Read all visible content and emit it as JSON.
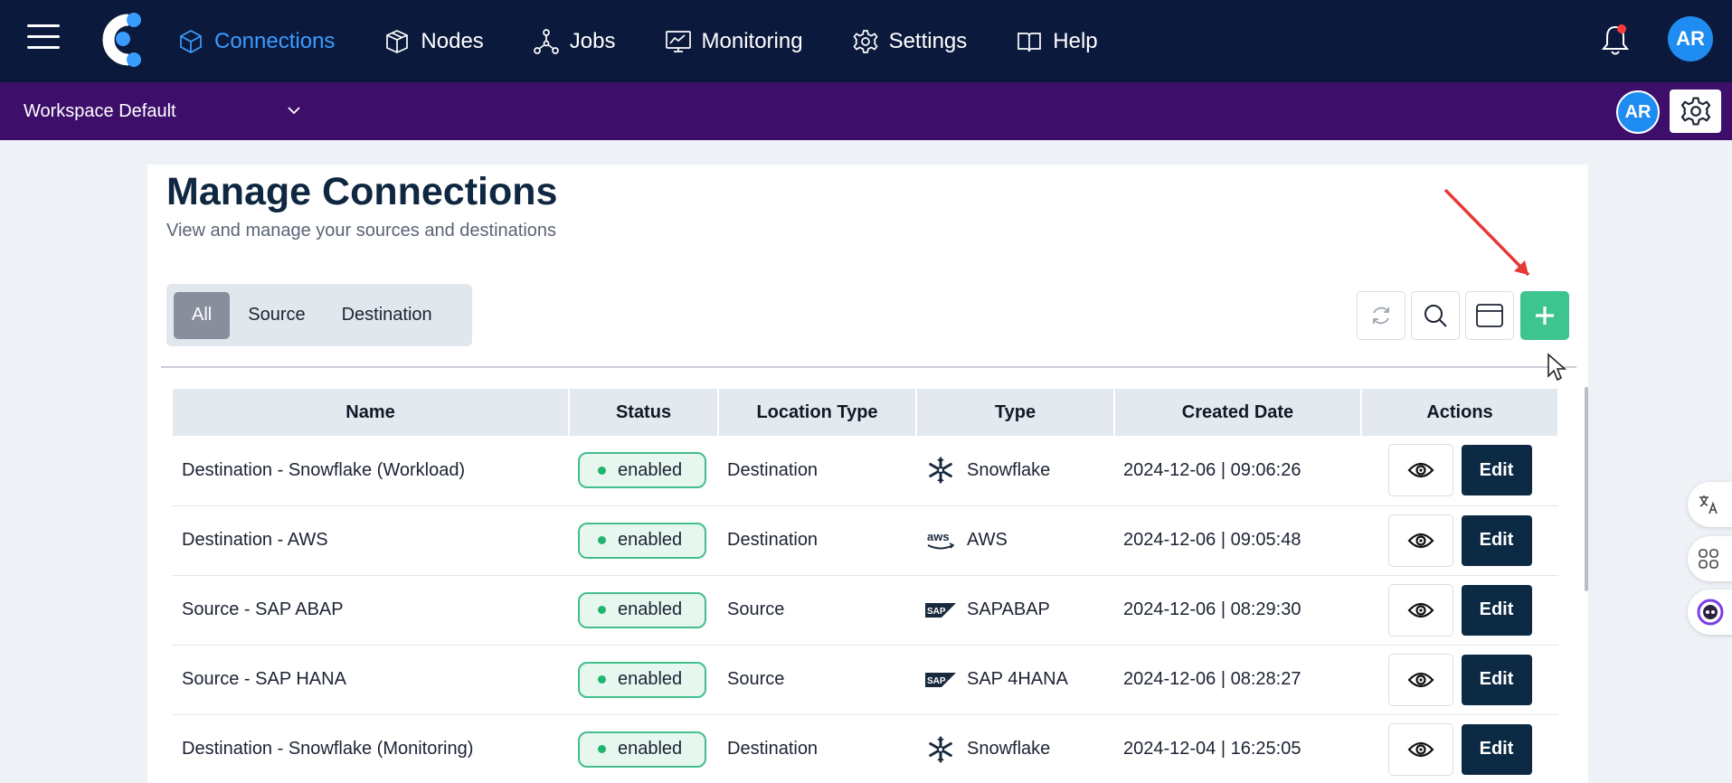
{
  "nav": {
    "items": [
      {
        "label": "Connections",
        "icon": "cube-icon",
        "active": true
      },
      {
        "label": "Nodes",
        "icon": "box-icon"
      },
      {
        "label": "Jobs",
        "icon": "network-icon"
      },
      {
        "label": "Monitoring",
        "icon": "monitor-chart-icon"
      },
      {
        "label": "Settings",
        "icon": "gear-icon"
      },
      {
        "label": "Help",
        "icon": "book-icon"
      }
    ],
    "avatar_initials": "AR",
    "accent_color": "#3b9cff"
  },
  "workspace": {
    "selected": "Workspace Default",
    "avatar_initials": "AR"
  },
  "page": {
    "title": "Manage Connections",
    "subtitle": "View and manage your sources and destinations"
  },
  "filters": {
    "all": "All",
    "source": "Source",
    "destination": "Destination",
    "selected": "All"
  },
  "table": {
    "headers": [
      "Name",
      "Status",
      "Location Type",
      "Type",
      "Created Date",
      "Actions"
    ],
    "rows": [
      {
        "name": "Destination - Snowflake (Workload)",
        "status": "enabled",
        "location": "Destination",
        "type": "Snowflake",
        "type_icon": "snowflake-icon",
        "created": "2024-12-06 | 09:06:26",
        "edit": "Edit"
      },
      {
        "name": "Destination - AWS",
        "status": "enabled",
        "location": "Destination",
        "type": "AWS",
        "type_icon": "aws-icon",
        "created": "2024-12-06 | 09:05:48",
        "edit": "Edit"
      },
      {
        "name": "Source - SAP ABAP",
        "status": "enabled",
        "location": "Source",
        "type": "SAPABAP",
        "type_icon": "sap-icon",
        "created": "2024-12-06 | 08:29:30",
        "edit": "Edit"
      },
      {
        "name": "Source - SAP HANA",
        "status": "enabled",
        "location": "Source",
        "type": "SAP 4HANA",
        "type_icon": "sap-icon",
        "created": "2024-12-06 | 08:28:27",
        "edit": "Edit"
      },
      {
        "name": "Destination - Snowflake (Monitoring)",
        "status": "enabled",
        "location": "Destination",
        "type": "Snowflake",
        "type_icon": "snowflake-icon",
        "created": "2024-12-04 | 16:25:05",
        "edit": "Edit"
      }
    ]
  },
  "colors": {
    "topnav_bg": "#0b1a3c",
    "workspace_bg": "#3d0f6b",
    "add_button": "#3ec48f",
    "edit_button": "#0c2a44",
    "status_enabled": "#22b46e"
  }
}
